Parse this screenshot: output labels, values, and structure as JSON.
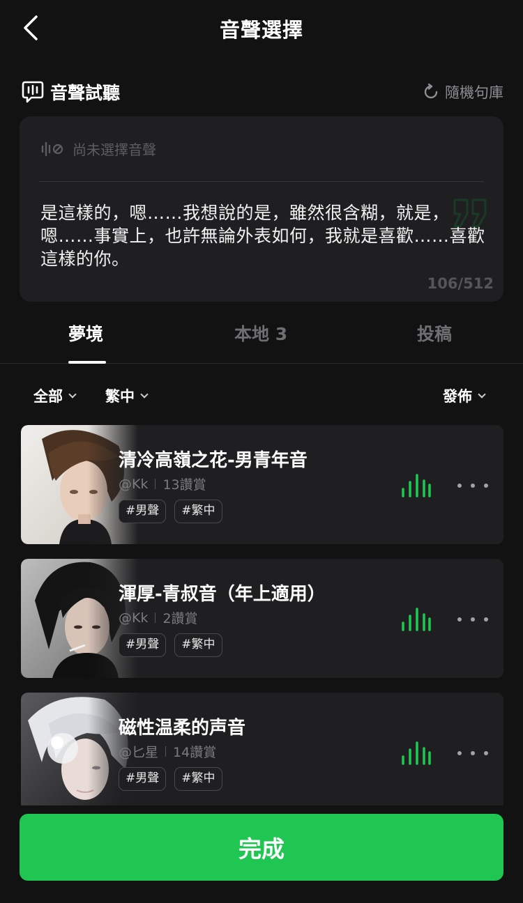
{
  "header": {
    "title": "音聲選擇",
    "back_icon": "chevron-left-icon"
  },
  "preview": {
    "title": "音聲試聽",
    "title_icon": "speech-bubble-waveform-icon",
    "random_label": "隨機句庫",
    "random_icon": "refresh-icon",
    "status_text": "尚未選擇音聲",
    "status_icon": "waveform-slash-icon",
    "text": "是這樣的，嗯……我想說的是，雖然很含糊，就是，嗯……事實上，也許無論外表如何，我就是喜歡……喜歡這樣的你。",
    "char_count": "106/512"
  },
  "tabs": [
    {
      "label": "夢境",
      "active": true
    },
    {
      "label": "本地 3",
      "active": false
    },
    {
      "label": "投稿",
      "active": false
    }
  ],
  "filters": {
    "category": "全部",
    "language": "繁中",
    "sort": "發佈"
  },
  "voices": [
    {
      "name": "清冷高嶺之花-男青年音",
      "author": "@Kk",
      "likes": "13讚賞",
      "tags": [
        "#男聲",
        "#繁中"
      ]
    },
    {
      "name": "渾厚-青叔音（年上適用）",
      "author": "@Kk",
      "likes": "2讚賞",
      "tags": [
        "#男聲",
        "#繁中"
      ]
    },
    {
      "name": "磁性温柔的声音",
      "author": "@匕星",
      "likes": "14讚賞",
      "tags": [
        "#男聲",
        "#繁中"
      ]
    }
  ],
  "footer": {
    "done_label": "完成"
  },
  "colors": {
    "accent_green": "#1fc752",
    "waveform_green": "#1fc752",
    "background": "#121213",
    "card": "#1f1f21"
  }
}
